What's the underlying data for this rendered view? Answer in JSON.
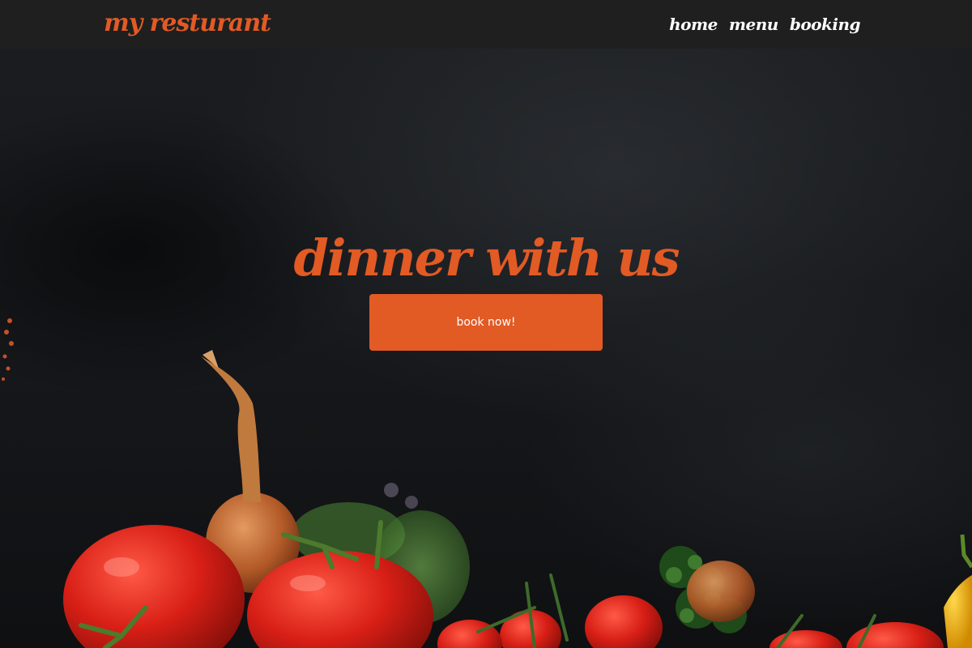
{
  "navbar": {
    "brand": "my resturant",
    "links": [
      {
        "label": "home"
      },
      {
        "label": "menu"
      },
      {
        "label": "booking"
      }
    ]
  },
  "hero": {
    "title": "dinner with us",
    "button_label": "book now!",
    "background_image": "dark slate surface with fresh tomatoes, onions and herbs"
  },
  "colors": {
    "accent": "#e25a24",
    "navbar_bg": "#1f1f1f",
    "hero_bg": "#15171a",
    "nav_text": "#ffffff"
  }
}
